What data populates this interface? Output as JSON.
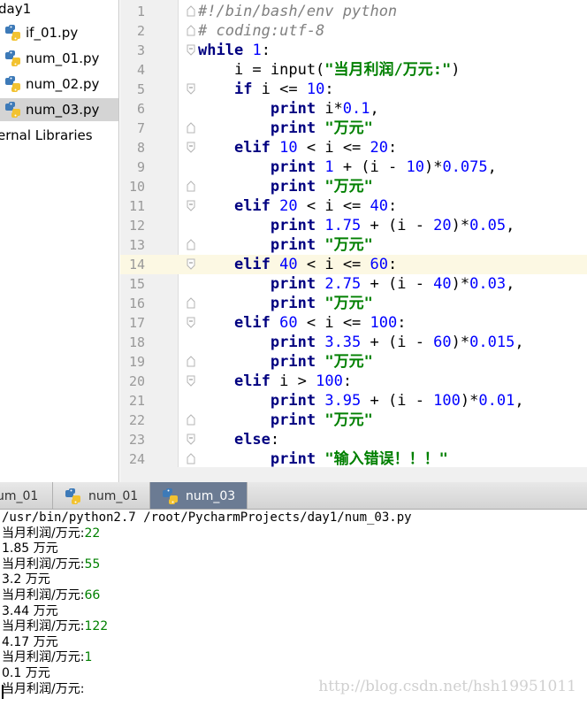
{
  "project_tree": {
    "root_label": "day1",
    "files": [
      "if_01.py",
      "num_01.py",
      "num_02.py",
      "num_03.py"
    ],
    "selected_file": "num_03.py",
    "external_libraries_label": "ernal Libraries"
  },
  "editor": {
    "current_line": 14,
    "lines": [
      {
        "n": "1",
        "tokens": [
          {
            "t": "#!/bin/bash/env python",
            "c": "comment"
          }
        ]
      },
      {
        "n": "2",
        "tokens": [
          {
            "t": "# coding:utf-8",
            "c": "comment"
          }
        ]
      },
      {
        "n": "3",
        "tokens": [
          {
            "t": "while",
            "c": "keyword"
          },
          {
            "t": " ",
            "c": "plain"
          },
          {
            "t": "1",
            "c": "number"
          },
          {
            "t": ":",
            "c": "plain"
          }
        ]
      },
      {
        "n": "4",
        "tokens": [
          {
            "t": "    i = input(",
            "c": "plain"
          },
          {
            "t": "\"当月利润/万元:\"",
            "c": "string"
          },
          {
            "t": ")",
            "c": "plain"
          }
        ]
      },
      {
        "n": "5",
        "tokens": [
          {
            "t": "    ",
            "c": "plain"
          },
          {
            "t": "if",
            "c": "keyword"
          },
          {
            "t": " i <= ",
            "c": "plain"
          },
          {
            "t": "10",
            "c": "number"
          },
          {
            "t": ":",
            "c": "plain"
          }
        ]
      },
      {
        "n": "6",
        "tokens": [
          {
            "t": "        ",
            "c": "plain"
          },
          {
            "t": "print",
            "c": "keyword"
          },
          {
            "t": " i*",
            "c": "plain"
          },
          {
            "t": "0.1",
            "c": "number"
          },
          {
            "t": ",",
            "c": "plain"
          }
        ]
      },
      {
        "n": "7",
        "tokens": [
          {
            "t": "        ",
            "c": "plain"
          },
          {
            "t": "print",
            "c": "keyword"
          },
          {
            "t": " ",
            "c": "plain"
          },
          {
            "t": "\"万元\"",
            "c": "string"
          }
        ]
      },
      {
        "n": "8",
        "tokens": [
          {
            "t": "    ",
            "c": "plain"
          },
          {
            "t": "elif",
            "c": "keyword"
          },
          {
            "t": " ",
            "c": "plain"
          },
          {
            "t": "10",
            "c": "number"
          },
          {
            "t": " < i <= ",
            "c": "plain"
          },
          {
            "t": "20",
            "c": "number"
          },
          {
            "t": ":",
            "c": "plain"
          }
        ]
      },
      {
        "n": "9",
        "tokens": [
          {
            "t": "        ",
            "c": "plain"
          },
          {
            "t": "print",
            "c": "keyword"
          },
          {
            "t": " ",
            "c": "plain"
          },
          {
            "t": "1",
            "c": "number"
          },
          {
            "t": " + (i - ",
            "c": "plain"
          },
          {
            "t": "10",
            "c": "number"
          },
          {
            "t": ")*",
            "c": "plain"
          },
          {
            "t": "0.075",
            "c": "number"
          },
          {
            "t": ",",
            "c": "plain"
          }
        ]
      },
      {
        "n": "10",
        "tokens": [
          {
            "t": "        ",
            "c": "plain"
          },
          {
            "t": "print",
            "c": "keyword"
          },
          {
            "t": " ",
            "c": "plain"
          },
          {
            "t": "\"万元\"",
            "c": "string"
          }
        ]
      },
      {
        "n": "11",
        "tokens": [
          {
            "t": "    ",
            "c": "plain"
          },
          {
            "t": "elif",
            "c": "keyword"
          },
          {
            "t": " ",
            "c": "plain"
          },
          {
            "t": "20",
            "c": "number"
          },
          {
            "t": " < i <= ",
            "c": "plain"
          },
          {
            "t": "40",
            "c": "number"
          },
          {
            "t": ":",
            "c": "plain"
          }
        ]
      },
      {
        "n": "12",
        "tokens": [
          {
            "t": "        ",
            "c": "plain"
          },
          {
            "t": "print",
            "c": "keyword"
          },
          {
            "t": " ",
            "c": "plain"
          },
          {
            "t": "1.75",
            "c": "number"
          },
          {
            "t": " + (i - ",
            "c": "plain"
          },
          {
            "t": "20",
            "c": "number"
          },
          {
            "t": ")*",
            "c": "plain"
          },
          {
            "t": "0.05",
            "c": "number"
          },
          {
            "t": ",",
            "c": "plain"
          }
        ]
      },
      {
        "n": "13",
        "tokens": [
          {
            "t": "        ",
            "c": "plain"
          },
          {
            "t": "print",
            "c": "keyword"
          },
          {
            "t": " ",
            "c": "plain"
          },
          {
            "t": "\"万元\"",
            "c": "string"
          }
        ]
      },
      {
        "n": "14",
        "tokens": [
          {
            "t": "    ",
            "c": "plain"
          },
          {
            "t": "elif",
            "c": "keyword"
          },
          {
            "t": " ",
            "c": "plain"
          },
          {
            "t": "40",
            "c": "number"
          },
          {
            "t": " < i <= ",
            "c": "plain"
          },
          {
            "t": "60",
            "c": "number"
          },
          {
            "t": ":",
            "c": "plain"
          }
        ]
      },
      {
        "n": "15",
        "tokens": [
          {
            "t": "        ",
            "c": "plain"
          },
          {
            "t": "print",
            "c": "keyword"
          },
          {
            "t": " ",
            "c": "plain"
          },
          {
            "t": "2.75",
            "c": "number"
          },
          {
            "t": " + (i - ",
            "c": "plain"
          },
          {
            "t": "40",
            "c": "number"
          },
          {
            "t": ")*",
            "c": "plain"
          },
          {
            "t": "0.03",
            "c": "number"
          },
          {
            "t": ",",
            "c": "plain"
          }
        ]
      },
      {
        "n": "16",
        "tokens": [
          {
            "t": "        ",
            "c": "plain"
          },
          {
            "t": "print",
            "c": "keyword"
          },
          {
            "t": " ",
            "c": "plain"
          },
          {
            "t": "\"万元\"",
            "c": "string"
          }
        ]
      },
      {
        "n": "17",
        "tokens": [
          {
            "t": "    ",
            "c": "plain"
          },
          {
            "t": "elif",
            "c": "keyword"
          },
          {
            "t": " ",
            "c": "plain"
          },
          {
            "t": "60",
            "c": "number"
          },
          {
            "t": " < i <= ",
            "c": "plain"
          },
          {
            "t": "100",
            "c": "number"
          },
          {
            "t": ":",
            "c": "plain"
          }
        ]
      },
      {
        "n": "18",
        "tokens": [
          {
            "t": "        ",
            "c": "plain"
          },
          {
            "t": "print",
            "c": "keyword"
          },
          {
            "t": " ",
            "c": "plain"
          },
          {
            "t": "3.35",
            "c": "number"
          },
          {
            "t": " + (i - ",
            "c": "plain"
          },
          {
            "t": "60",
            "c": "number"
          },
          {
            "t": ")*",
            "c": "plain"
          },
          {
            "t": "0.015",
            "c": "number"
          },
          {
            "t": ",",
            "c": "plain"
          }
        ]
      },
      {
        "n": "19",
        "tokens": [
          {
            "t": "        ",
            "c": "plain"
          },
          {
            "t": "print",
            "c": "keyword"
          },
          {
            "t": " ",
            "c": "plain"
          },
          {
            "t": "\"万元\"",
            "c": "string"
          }
        ]
      },
      {
        "n": "20",
        "tokens": [
          {
            "t": "    ",
            "c": "plain"
          },
          {
            "t": "elif",
            "c": "keyword"
          },
          {
            "t": " i > ",
            "c": "plain"
          },
          {
            "t": "100",
            "c": "number"
          },
          {
            "t": ":",
            "c": "plain"
          }
        ]
      },
      {
        "n": "21",
        "tokens": [
          {
            "t": "        ",
            "c": "plain"
          },
          {
            "t": "print",
            "c": "keyword"
          },
          {
            "t": " ",
            "c": "plain"
          },
          {
            "t": "3.95",
            "c": "number"
          },
          {
            "t": " + (i - ",
            "c": "plain"
          },
          {
            "t": "100",
            "c": "number"
          },
          {
            "t": ")*",
            "c": "plain"
          },
          {
            "t": "0.01",
            "c": "number"
          },
          {
            "t": ",",
            "c": "plain"
          }
        ]
      },
      {
        "n": "22",
        "tokens": [
          {
            "t": "        ",
            "c": "plain"
          },
          {
            "t": "print",
            "c": "keyword"
          },
          {
            "t": " ",
            "c": "plain"
          },
          {
            "t": "\"万元\"",
            "c": "string"
          }
        ]
      },
      {
        "n": "23",
        "tokens": [
          {
            "t": "    ",
            "c": "plain"
          },
          {
            "t": "else",
            "c": "keyword"
          },
          {
            "t": ":",
            "c": "plain"
          }
        ]
      },
      {
        "n": "24",
        "tokens": [
          {
            "t": "        ",
            "c": "plain"
          },
          {
            "t": "print",
            "c": "keyword"
          },
          {
            "t": " ",
            "c": "plain"
          },
          {
            "t": "\"输入错误！！！\"",
            "c": "string"
          }
        ]
      }
    ]
  },
  "run_tabs": [
    {
      "label": "um_01",
      "active": false
    },
    {
      "label": "num_01",
      "active": false
    },
    {
      "label": "num_03",
      "active": true
    }
  ],
  "console": {
    "lines": [
      {
        "kind": "cmd",
        "text": "/usr/bin/python2.7 /root/PycharmProjects/day1/num_03.py"
      },
      {
        "kind": "prompt",
        "text": "当月利润/万元:",
        "input": "22"
      },
      {
        "kind": "out",
        "text": "1.85 万元"
      },
      {
        "kind": "prompt",
        "text": "当月利润/万元:",
        "input": "55"
      },
      {
        "kind": "out",
        "text": "3.2 万元"
      },
      {
        "kind": "prompt",
        "text": "当月利润/万元:",
        "input": "66"
      },
      {
        "kind": "out",
        "text": "3.44 万元"
      },
      {
        "kind": "prompt",
        "text": "当月利润/万元:",
        "input": "122"
      },
      {
        "kind": "out",
        "text": "4.17 万元"
      },
      {
        "kind": "prompt",
        "text": "当月利润/万元:",
        "input": "1"
      },
      {
        "kind": "out",
        "text": "0.1 万元"
      },
      {
        "kind": "prompt",
        "text": "当月利润/万元:",
        "input": ""
      }
    ],
    "watermark": "http://blog.csdn.net/hsh19951011"
  },
  "colors": {
    "keyword": "#000080",
    "number": "#0000ff",
    "string": "#008000",
    "comment": "#808080",
    "console_input": "#008000",
    "active_tab": "#6b7b93",
    "current_line": "#fcf8e3"
  }
}
